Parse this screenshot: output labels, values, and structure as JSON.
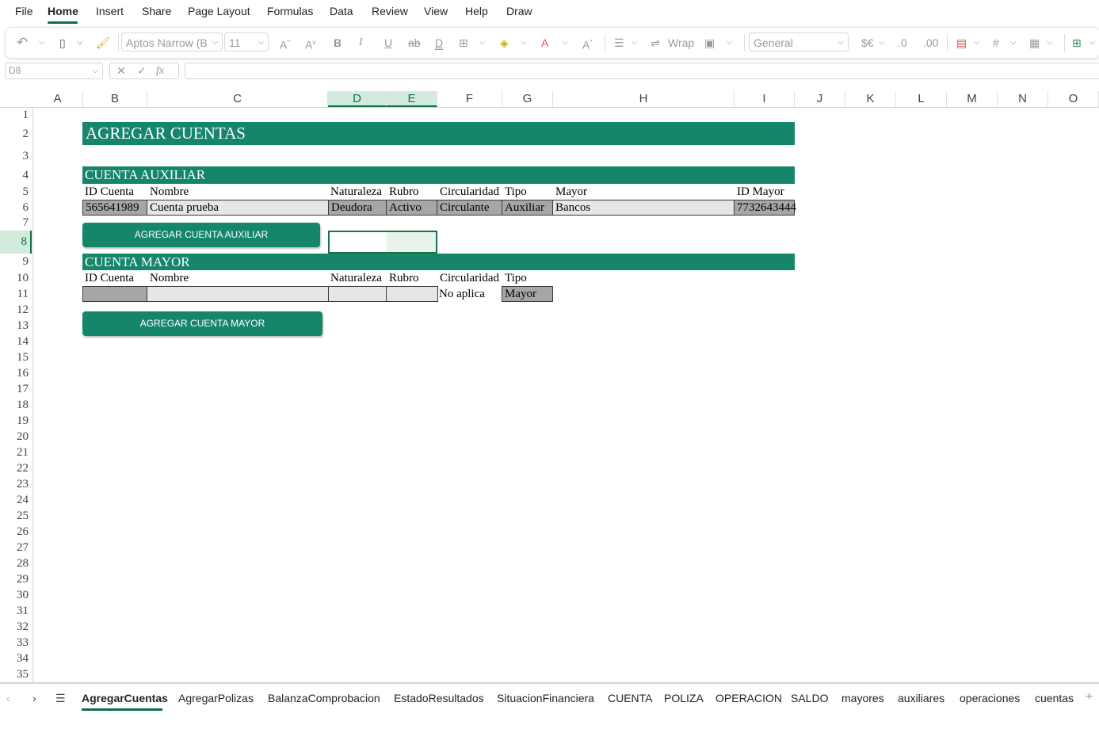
{
  "menu": {
    "items": [
      "File",
      "Home",
      "Insert",
      "Share",
      "Page Layout",
      "Formulas",
      "Data",
      "Review",
      "View",
      "Help",
      "Draw"
    ],
    "active": "Home"
  },
  "ribbon": {
    "font_name": "Aptos Narrow (B",
    "font_size": "11",
    "wrap_label": "Wrap",
    "number_format": "General"
  },
  "formula_bar": {
    "name_box": "D8",
    "formula": ""
  },
  "grid": {
    "columns": [
      "A",
      "B",
      "C",
      "D",
      "E",
      "F",
      "G",
      "H",
      "I",
      "J",
      "K",
      "L",
      "M",
      "N",
      "O"
    ],
    "selected_columns": [
      "D",
      "E"
    ],
    "rows": [
      "1",
      "2",
      "3",
      "4",
      "5",
      "6",
      "7",
      "8",
      "9",
      "10",
      "11",
      "12",
      "13",
      "14",
      "15",
      "16",
      "17",
      "18",
      "19",
      "20",
      "21",
      "22",
      "23",
      "24",
      "25",
      "26",
      "27",
      "28",
      "29",
      "30",
      "31",
      "32",
      "33",
      "34",
      "35"
    ],
    "selected_row": "8"
  },
  "sheet": {
    "title": "AGREGAR CUENTAS",
    "auxiliar": {
      "heading": "CUENTA AUXILIAR",
      "headers": [
        "ID Cuenta",
        "Nombre",
        "Naturaleza",
        "Rubro",
        "Circularidad",
        "Tipo",
        "Mayor",
        "ID Mayor"
      ],
      "values": [
        "565641989",
        "Cuenta prueba",
        "Deudora",
        "Activo",
        "Circulante",
        "Auxiliar",
        "Bancos",
        "7732643444"
      ],
      "button": "AGREGAR CUENTA AUXILIAR"
    },
    "mayor": {
      "heading": "CUENTA MAYOR",
      "headers": [
        "ID Cuenta",
        "Nombre",
        "Naturaleza",
        "Rubro",
        "Circularidad",
        "Tipo"
      ],
      "values": [
        "",
        "",
        "",
        "",
        "No aplica",
        "Mayor"
      ],
      "button": "AGREGAR CUENTA MAYOR"
    }
  },
  "tabs": {
    "items": [
      "AgregarCuentas",
      "AgregarPolizas",
      "BalanzaComprobacion",
      "EstadoResultados",
      "SituacionFinanciera",
      "CUENTA",
      "POLIZA",
      "OPERACION",
      "SALDO",
      "mayores",
      "auxiliares",
      "operaciones",
      "cuentas"
    ],
    "active": "AgregarCuentas"
  },
  "colors": {
    "accent": "#0f6e47",
    "band": "#15866a",
    "dark_cell": "#a6a6a6",
    "light_cell": "#e6e6e6"
  }
}
